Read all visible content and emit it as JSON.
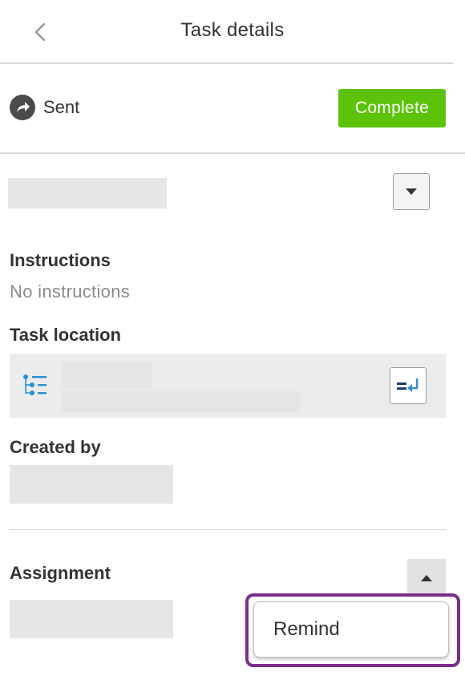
{
  "header": {
    "title": "Task details",
    "back_icon": "chevron-left-icon"
  },
  "status": {
    "icon": "forward-arrow-icon",
    "label": "Sent",
    "complete_label": "Complete",
    "complete_color": "#5cc30a"
  },
  "instructions": {
    "label": "Instructions",
    "value": "No instructions"
  },
  "task_location": {
    "label": "Task location",
    "list_icon": "hierarchy-list-icon",
    "action_icon": "insert-location-icon"
  },
  "created_by": {
    "label": "Created by"
  },
  "assignment": {
    "label": "Assignment",
    "remind_label": "Remind",
    "highlight_color": "#7b2d8e"
  }
}
